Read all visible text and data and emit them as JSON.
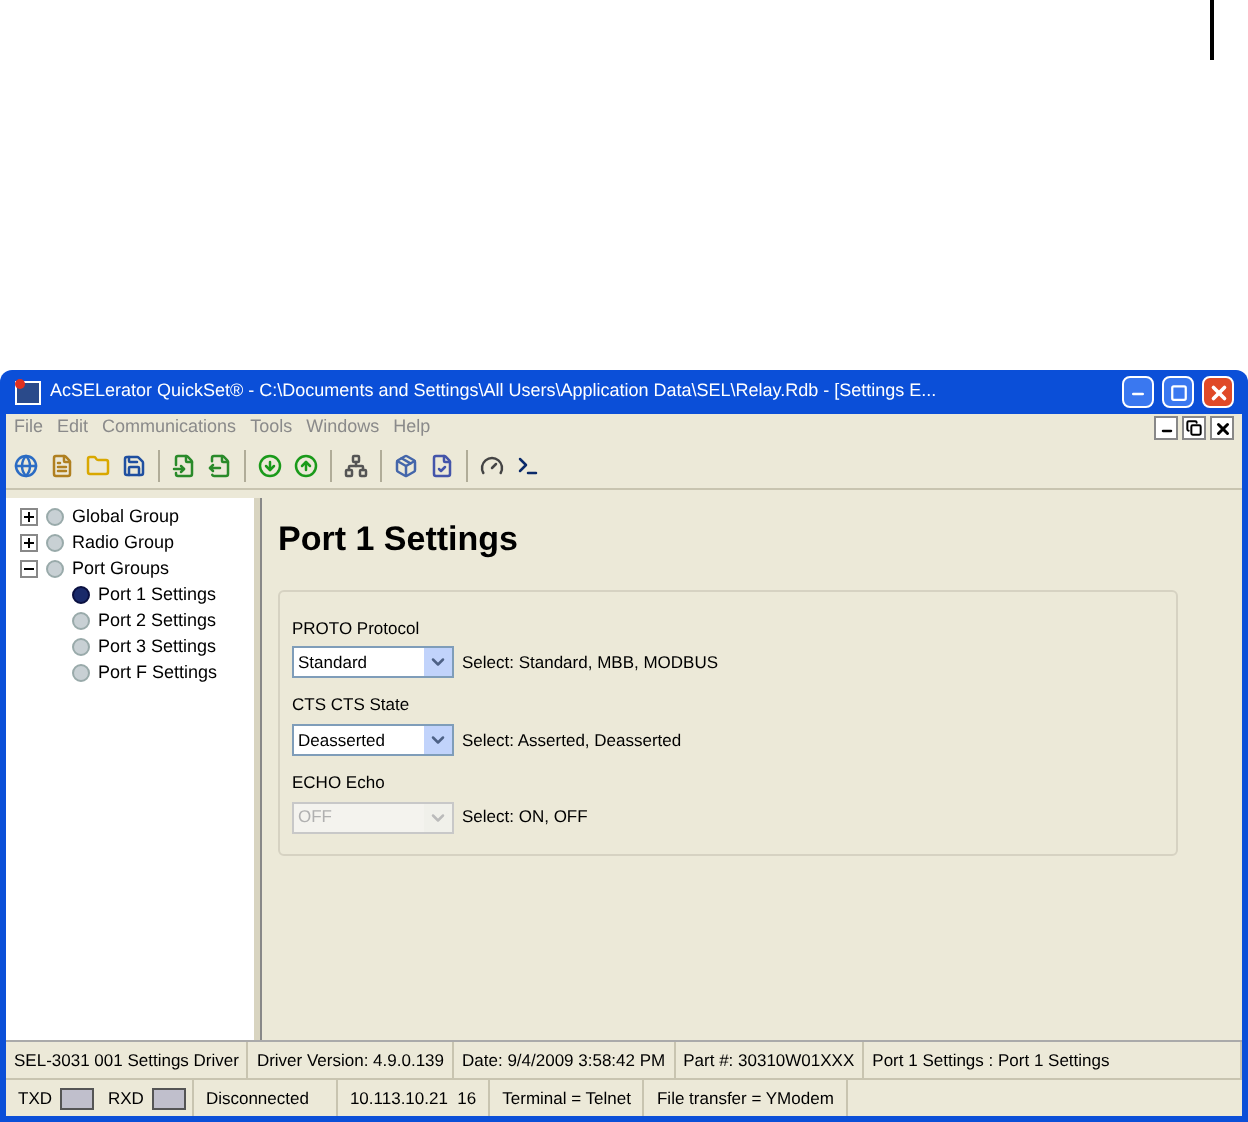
{
  "window": {
    "title": "AcSELerator QuickSet® - C:\\Documents and Settings\\All Users\\Application Data\\SEL\\Relay.Rdb - [Settings E..."
  },
  "menu": [
    "File",
    "Edit",
    "Communications",
    "Tools",
    "Windows",
    "Help"
  ],
  "tree": [
    {
      "label": "Global Group",
      "expanded": false,
      "selected": false
    },
    {
      "label": "Radio Group",
      "expanded": false,
      "selected": false
    },
    {
      "label": "Port Groups",
      "expanded": true,
      "selected": false,
      "children": [
        {
          "label": "Port 1 Settings",
          "selected": true
        },
        {
          "label": "Port 2 Settings",
          "selected": false
        },
        {
          "label": "Port 3 Settings",
          "selected": false
        },
        {
          "label": "Port F Settings",
          "selected": false
        }
      ]
    }
  ],
  "page": {
    "heading": "Port 1 Settings",
    "fields": [
      {
        "label": "PROTO Protocol",
        "value": "Standard",
        "hint": "Select: Standard, MBB, MODBUS",
        "disabled": false
      },
      {
        "label": "CTS CTS State",
        "value": "Deasserted",
        "hint": "Select: Asserted, Deasserted",
        "disabled": false
      },
      {
        "label": "ECHO Echo",
        "value": "OFF",
        "hint": "Select: ON, OFF",
        "disabled": true
      }
    ]
  },
  "status_bar": [
    "SEL-3031 001 Settings Driver",
    "Driver Version: 4.9.0.139",
    "Date: 9/4/2009 3:58:42 PM",
    "Part #: 30310W01XXX",
    "Port 1 Settings : Port 1 Settings"
  ],
  "connection_bar": {
    "indicators": [
      "TXD",
      "RXD"
    ],
    "fields": [
      "Disconnected",
      "10.113.10.21  16",
      "Terminal = Telnet",
      "File transfer = YModem"
    ]
  }
}
